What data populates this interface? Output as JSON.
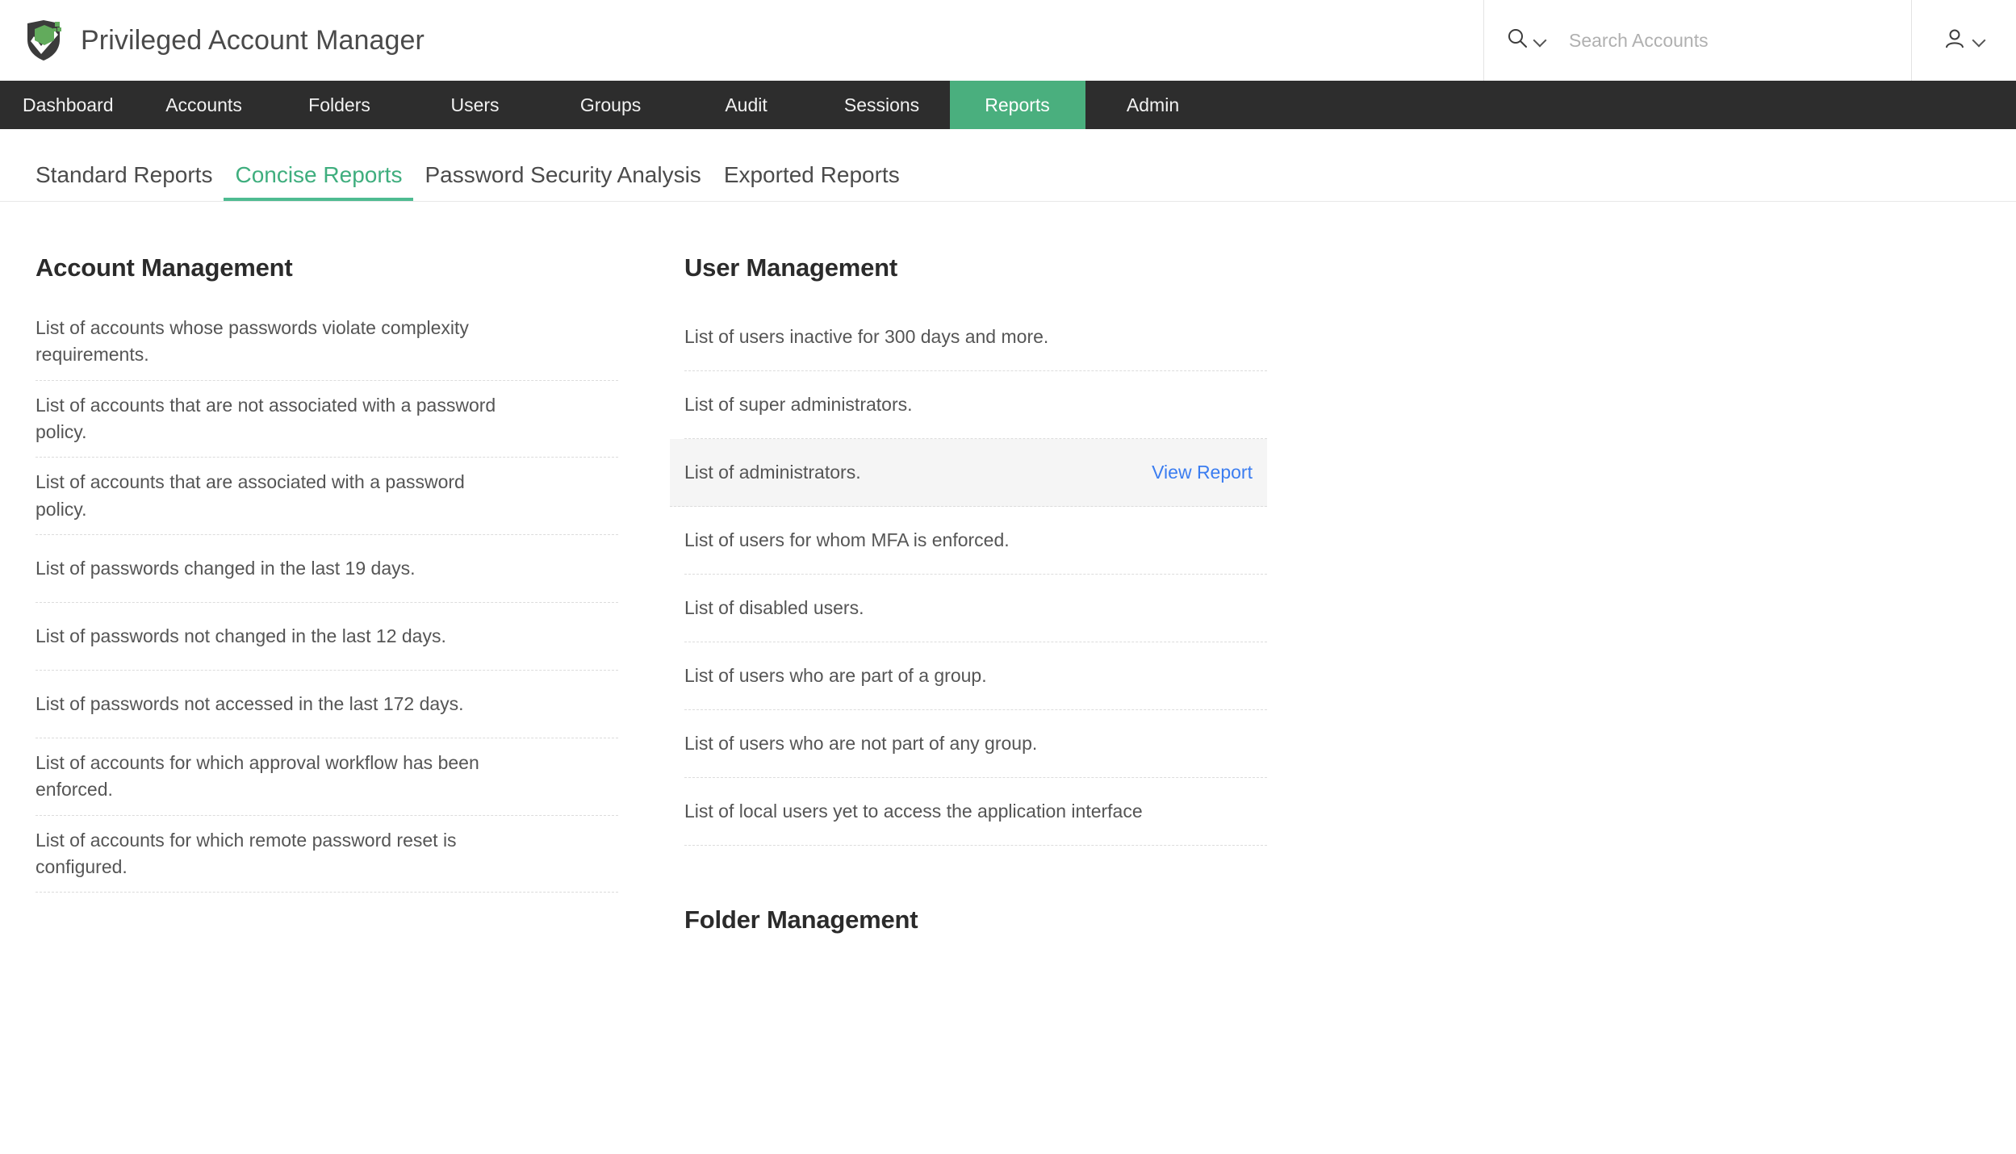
{
  "header": {
    "brand_title": "Privileged Account Manager",
    "logo_icon": "shield-logo-icon",
    "search": {
      "icon": "search-icon",
      "dropdown_icon": "chevron-down-icon",
      "placeholder": "Search Accounts",
      "value": ""
    },
    "user_menu": {
      "icon": "user-icon",
      "dropdown_icon": "chevron-down-icon"
    }
  },
  "mainnav": {
    "active": "Reports",
    "items": [
      {
        "label": "Dashboard"
      },
      {
        "label": "Accounts"
      },
      {
        "label": "Folders"
      },
      {
        "label": "Users"
      },
      {
        "label": "Groups"
      },
      {
        "label": "Audit"
      },
      {
        "label": "Sessions"
      },
      {
        "label": "Reports"
      },
      {
        "label": "Admin"
      }
    ]
  },
  "subtabs": {
    "active": "Concise Reports",
    "items": [
      {
        "label": "Standard Reports"
      },
      {
        "label": "Concise Reports"
      },
      {
        "label": "Password Security Analysis"
      },
      {
        "label": "Exported Reports"
      }
    ]
  },
  "left_column": {
    "section_title": "Account Management",
    "rows": [
      {
        "label": "List of accounts whose passwords violate complexity requirements."
      },
      {
        "label": "List of accounts that are not associated with a password policy."
      },
      {
        "label": "List of accounts that are associated with a password policy."
      },
      {
        "label": "List of passwords changed in the last 19 days."
      },
      {
        "label": "List of passwords not changed in the last 12 days."
      },
      {
        "label": "List of passwords not accessed in the last 172 days."
      },
      {
        "label": "List of accounts for which approval workflow has been enforced."
      },
      {
        "label": "List of accounts for which remote password reset is configured."
      }
    ]
  },
  "right_column": {
    "section_title": "User Management",
    "folder_section_title": "Folder Management",
    "view_report_label": "View Report",
    "rows": [
      {
        "label": "List of users inactive for 300 days and more.",
        "hovered": false
      },
      {
        "label": "List of super administrators.",
        "hovered": false
      },
      {
        "label": "List of administrators.",
        "hovered": true
      },
      {
        "label": "List of users for whom MFA is enforced.",
        "hovered": false
      },
      {
        "label": "List of disabled users.",
        "hovered": false
      },
      {
        "label": "List of users who are part of a group.",
        "hovered": false
      },
      {
        "label": "List of users who are not part of any group.",
        "hovered": false
      },
      {
        "label": "List of local users yet to access the application interface",
        "hovered": false
      }
    ]
  },
  "colors": {
    "nav_background": "#2d2d2d",
    "accent_green": "#4aaf7e",
    "tab_active_green": "#3fae7e",
    "link_blue": "#3b7df0",
    "hover_row_background": "#f5f5f5",
    "body_text": "#555555"
  }
}
